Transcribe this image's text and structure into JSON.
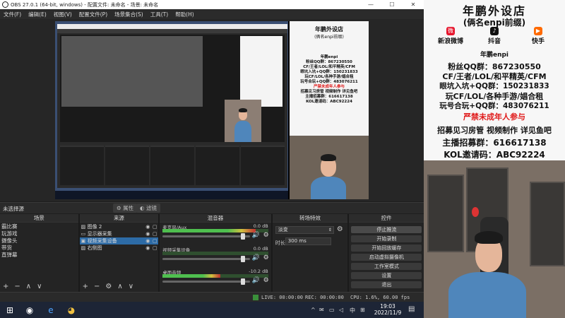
{
  "window": {
    "title": "OBS 27.0.1 (64-bit, windows) - 配置文件: 未命名 - 场景: 未命名",
    "controls": [
      "—",
      "☐",
      "✕"
    ]
  },
  "menu": [
    "文件(F)",
    "编辑(E)",
    "视图(V)",
    "配置文件(P)",
    "场景集合(S)",
    "工具(T)",
    "帮助(H)"
  ],
  "preview": {
    "no_source": "未选择源",
    "properties": "属性",
    "filters": "滤镜"
  },
  "scenes": {
    "title": "场景",
    "items": [
      "霸比赛",
      "玩游戏",
      "摄像头",
      "带货",
      "直弹幕"
    ]
  },
  "sources": {
    "title": "来源",
    "items": [
      {
        "icon": "image-icon",
        "name": "图像 2",
        "selected": false
      },
      {
        "icon": "display-icon",
        "name": "显示器采集",
        "selected": false
      },
      {
        "icon": "camera-icon",
        "name": "视频采集设备",
        "selected": true
      },
      {
        "icon": "image-icon",
        "name": "右侧图",
        "selected": false
      }
    ]
  },
  "mixer": {
    "title": "混音器",
    "channels": [
      {
        "name": "麦克风/Aux",
        "db": "0.0 dB",
        "level": 0.88,
        "volume": 0.92
      },
      {
        "name": "视频采集设备",
        "db": "0.0 dB",
        "level": 0.0,
        "volume": 0.92
      },
      {
        "name": "桌面音频",
        "db": "-10.2 dB",
        "level": 0.55,
        "volume": 0.92
      }
    ]
  },
  "transitions": {
    "title": "转场特效",
    "selected": "淡变",
    "duration_label": "时长",
    "duration": "300 ms"
  },
  "controls": {
    "title": "控件",
    "buttons": [
      "停止推流",
      "开始录制",
      "开始回放缓存",
      "启动虚拟摄像机",
      "工作室模式",
      "设置",
      "退出"
    ]
  },
  "status": {
    "live": "LIVE: 00:00:00",
    "rec": "REC: 00:00:00",
    "cpu": "CPU: 1.6%, 60.00 fps"
  },
  "taskbar": {
    "apps": [
      "⊞",
      "🔍",
      "◉",
      "e",
      "◕"
    ],
    "tray": [
      "^",
      "✉",
      "▭",
      "◁",
      "中",
      "⊞"
    ],
    "time": "19:03",
    "date": "2022/11/9",
    "notification": "▤"
  },
  "poster": {
    "shop_name": "年鹏外设店",
    "shop_sub": "(俩名enpi前缀)",
    "social": [
      {
        "label": "新浪微博",
        "icon": "weibo-icon",
        "color": "#e6162d"
      },
      {
        "label": "抖音",
        "icon": "douyin-icon",
        "color": "#111111"
      },
      {
        "label": "快手",
        "icon": "kuaishou-icon",
        "color": "#ff6a00"
      }
    ],
    "handle": "年鹏enpi",
    "lines": [
      {
        "text": "粉丝QQ群：867230550",
        "color": "#111111"
      },
      {
        "text": "CF/王者/LOL/和平精英/CFM",
        "color": "#111111"
      },
      {
        "text": "眼坑入坑+QQ群：150231833",
        "color": "#111111",
        "highlight": "150231833"
      },
      {
        "text": "玩CF/LOL/各种手游/娼合租",
        "color": "#111111"
      },
      {
        "text": "玩号合玩+QQ群：483076211",
        "color": "#111111",
        "highlight": "483076211"
      },
      {
        "text": "严禁未成年人参与",
        "color": "#e01b1b"
      },
      {
        "text": "招募见习房管 视频制作 详见鱼吧",
        "color": "#111111"
      },
      {
        "text": "主播招募群：616617138",
        "color": "#111111"
      },
      {
        "text": "KOL邀请码：ABC92224",
        "color": "#111111"
      }
    ]
  }
}
